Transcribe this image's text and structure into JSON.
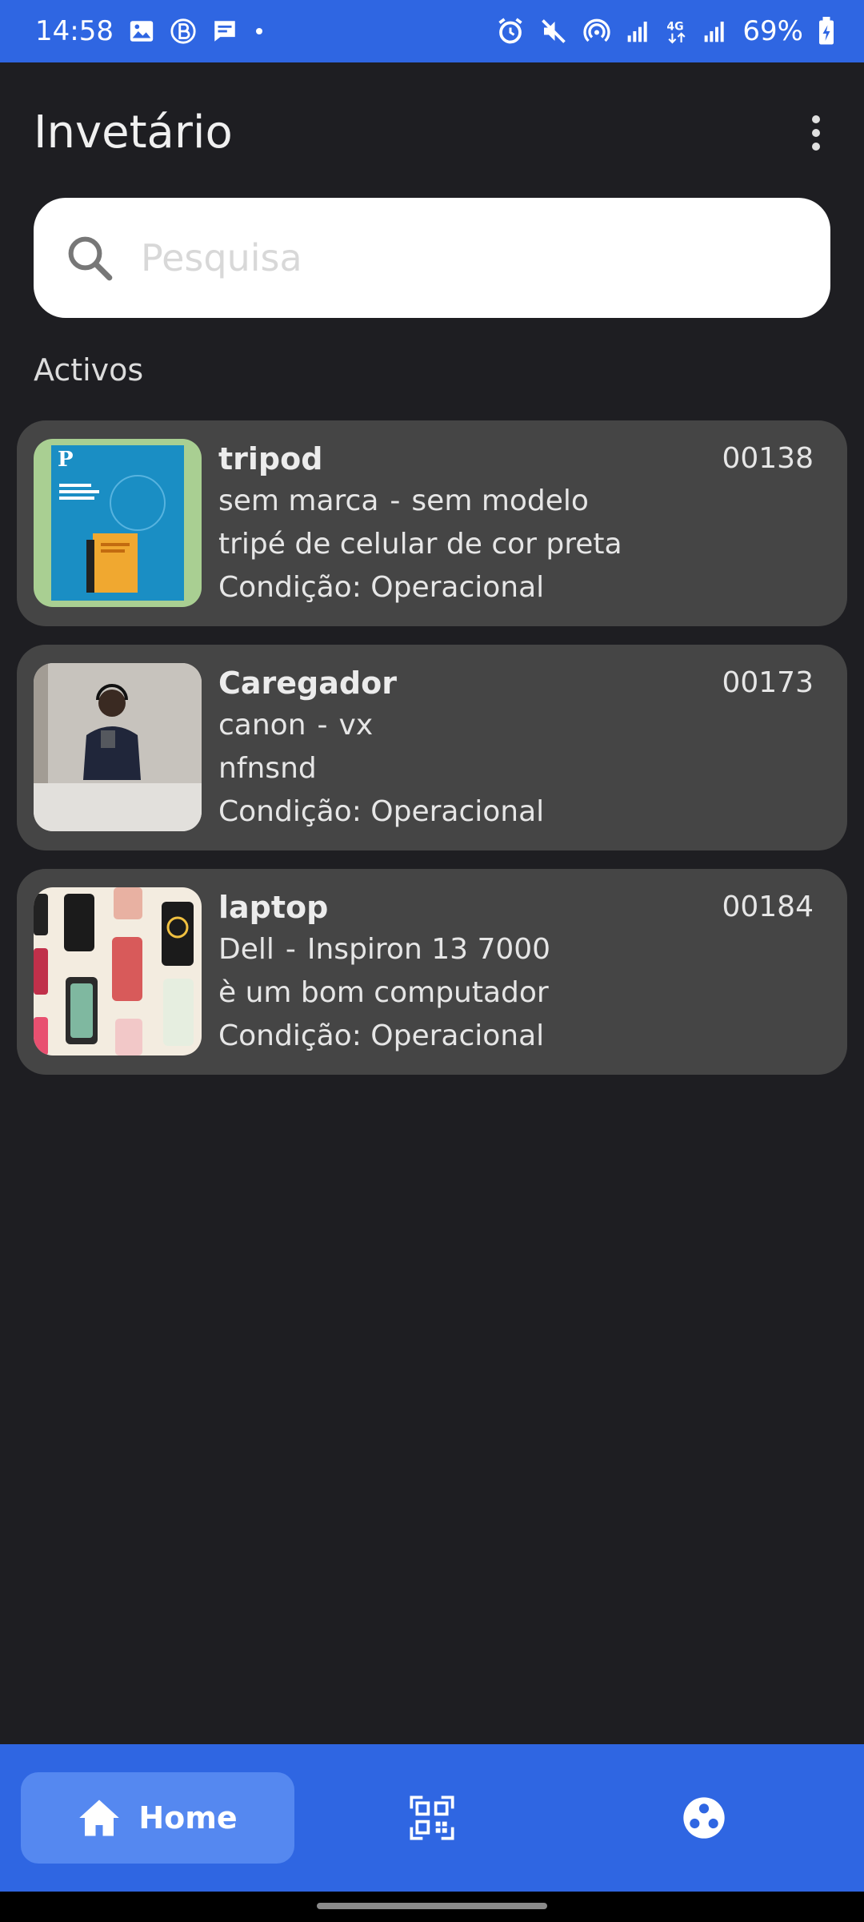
{
  "status_bar": {
    "time": "14:58",
    "battery": "69%",
    "left_icons": [
      "gallery-icon",
      "b-circle-icon",
      "message-icon",
      "dot-icon"
    ],
    "right_icons": [
      "alarm-icon",
      "mute-icon",
      "hotspot-icon",
      "signal-icon",
      "4g-icon",
      "signal-icon",
      "battery-icon"
    ]
  },
  "header": {
    "title": "Invetário",
    "more_icon": "more-vert-icon"
  },
  "search": {
    "placeholder": "Pesquisa",
    "value": ""
  },
  "section": {
    "label": "Activos"
  },
  "assets": [
    {
      "name": "tripod",
      "code": "00138",
      "brand": "sem marca",
      "model": "sem modelo",
      "description": "tripé de celular de cor preta",
      "condition": "Condição: Operacional"
    },
    {
      "name": "Caregador",
      "code": "00173",
      "brand": "canon",
      "model": "vx",
      "description": "nfnsnd",
      "condition": "Condição: Operacional"
    },
    {
      "name": "laptop",
      "code": "00184",
      "brand": "Dell",
      "model": "Inspiron 13 7000",
      "description": "è um bom computador",
      "condition": "Condição: Operacional"
    }
  ],
  "bottom_nav": {
    "home_label": "Home",
    "items": [
      "home-icon",
      "qr-code-icon",
      "group-icon"
    ]
  },
  "colors": {
    "primary": "#2f66e2",
    "background": "#1e1e22",
    "card": "#454545"
  },
  "separator": "-"
}
